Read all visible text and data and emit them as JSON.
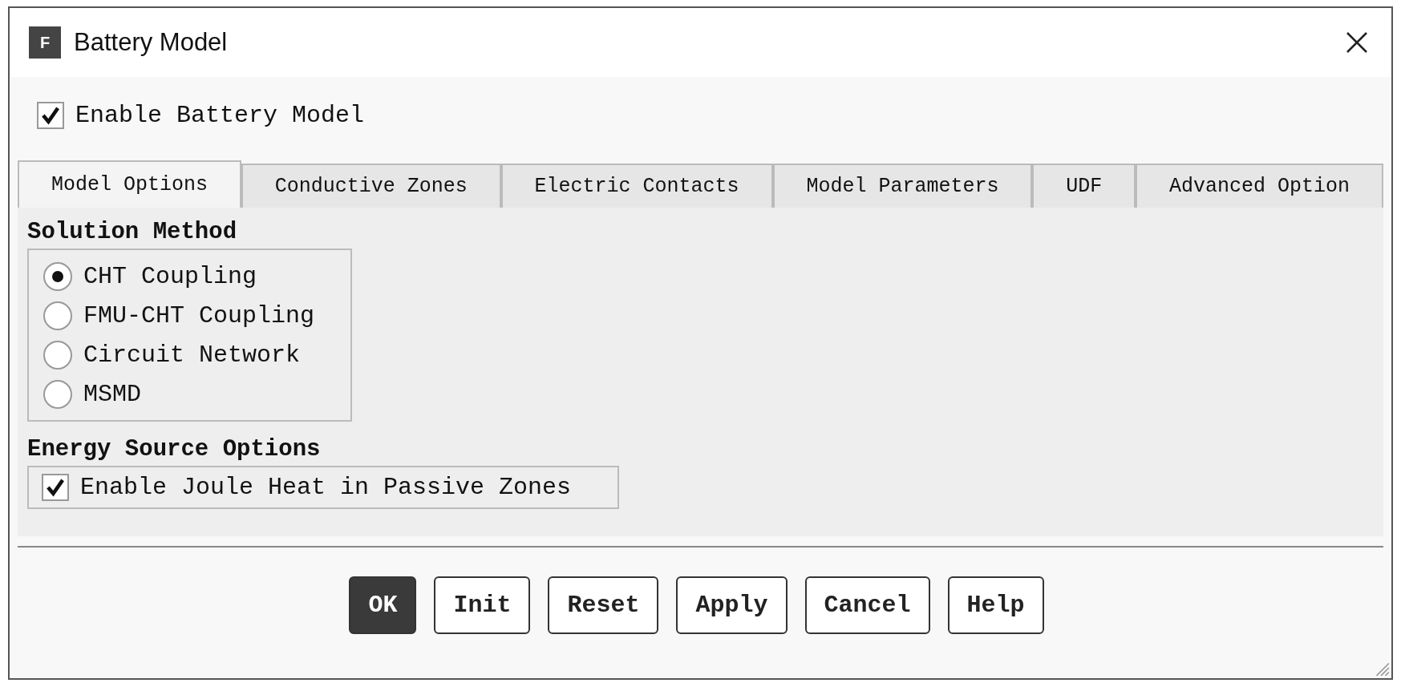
{
  "window": {
    "title": "Battery Model",
    "logo": "F"
  },
  "enable_model": {
    "label": "Enable Battery Model",
    "checked": true
  },
  "tabs": [
    {
      "label": "Model Options",
      "selected": true
    },
    {
      "label": "Conductive Zones",
      "selected": false
    },
    {
      "label": "Electric Contacts",
      "selected": false
    },
    {
      "label": "Model Parameters",
      "selected": false
    },
    {
      "label": "UDF",
      "selected": false
    },
    {
      "label": "Advanced Option",
      "selected": false
    }
  ],
  "solution_method": {
    "title": "Solution Method",
    "options": [
      {
        "label": "CHT Coupling",
        "selected": true
      },
      {
        "label": "FMU-CHT Coupling",
        "selected": false
      },
      {
        "label": "Circuit Network",
        "selected": false
      },
      {
        "label": "MSMD",
        "selected": false
      }
    ]
  },
  "energy_source": {
    "title": "Energy Source Options",
    "options": [
      {
        "label": "Enable Joule Heat in Passive Zones",
        "checked": true
      }
    ]
  },
  "buttons": [
    {
      "label": "OK",
      "kind": "default"
    },
    {
      "label": "Init",
      "kind": "normal"
    },
    {
      "label": "Reset",
      "kind": "normal"
    },
    {
      "label": "Apply",
      "kind": "normal"
    },
    {
      "label": "Cancel",
      "kind": "normal"
    },
    {
      "label": "Help",
      "kind": "normal"
    }
  ]
}
